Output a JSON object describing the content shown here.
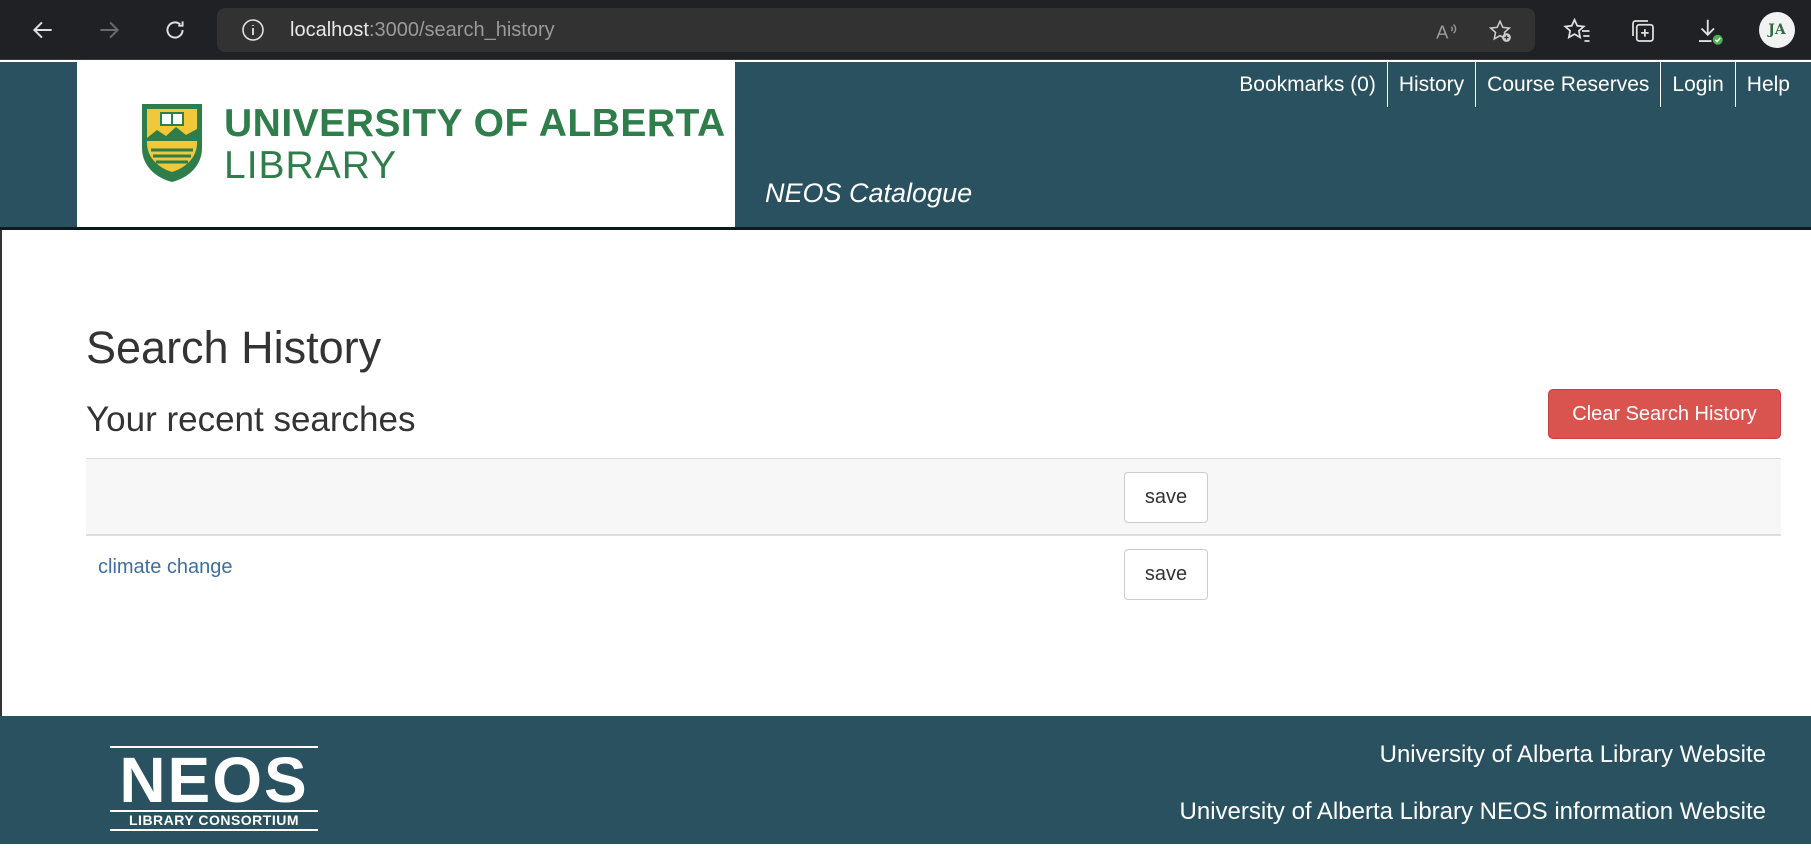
{
  "browser": {
    "url_host": "localhost",
    "url_path": ":3000/search_history",
    "avatar_initials": "JA",
    "icons": [
      "back-icon",
      "forward-icon",
      "reload-icon",
      "info-icon",
      "read-aloud-icon",
      "add-favorite-icon",
      "favorites-icon",
      "collections-icon",
      "downloads-icon"
    ]
  },
  "header": {
    "logo_line1": "UNIVERSITY OF ALBERTA",
    "logo_line2": "LIBRARY",
    "catalogue_title": "NEOS Catalogue",
    "nav": [
      {
        "label": "Bookmarks (0)"
      },
      {
        "label": "History"
      },
      {
        "label": "Course Reserves"
      },
      {
        "label": "Login"
      },
      {
        "label": "Help"
      }
    ]
  },
  "main": {
    "title": "Search History",
    "subtitle": "Your recent searches",
    "clear_label": "Clear Search History",
    "searches": [
      {
        "query": "",
        "save_label": "save"
      },
      {
        "query": "climate change",
        "save_label": "save"
      }
    ]
  },
  "footer": {
    "logo_word": "NEOS",
    "logo_sub": "LIBRARY CONSORTIUM",
    "links": [
      {
        "label": "University of Alberta Library Website"
      },
      {
        "label": "University of Alberta Library NEOS information Website"
      }
    ]
  },
  "colors": {
    "header_bg": "#295160",
    "brand_green": "#2e7d4a",
    "danger": "#d9534f",
    "link": "#3e6ea1"
  }
}
